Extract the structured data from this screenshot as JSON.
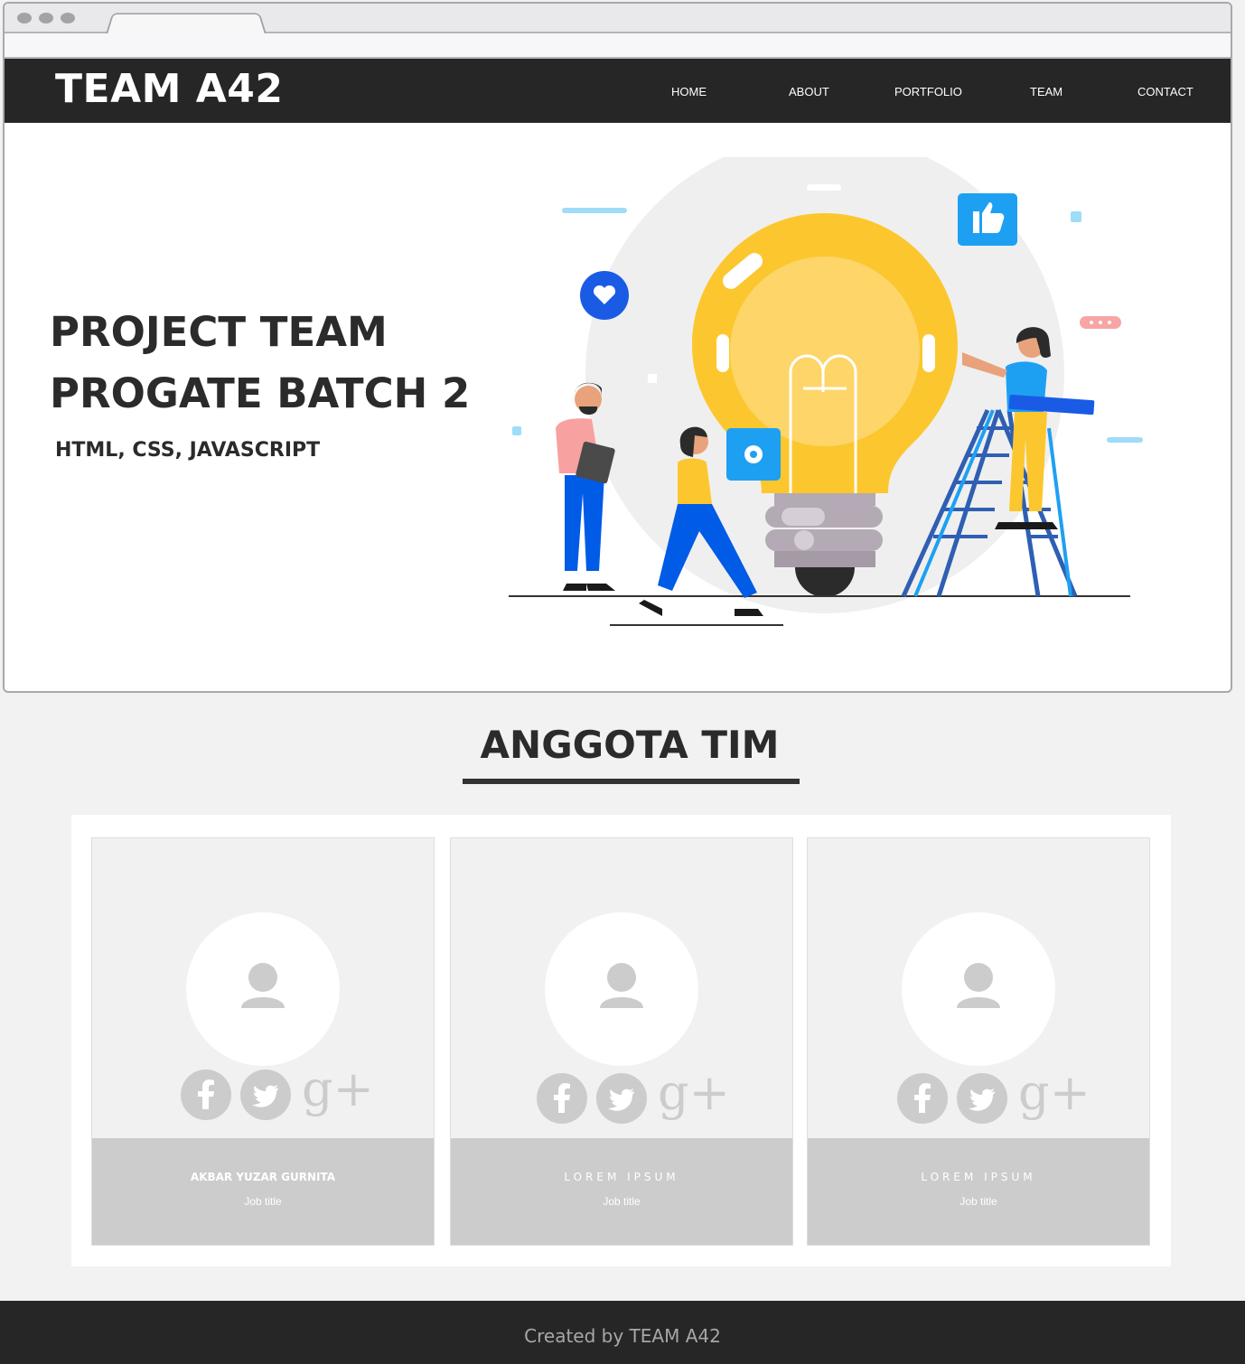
{
  "navbar": {
    "brand": "TEAM A42",
    "items": [
      "HOME",
      "ABOUT",
      "PORTFOLIO",
      "TEAM",
      "CONTACT"
    ]
  },
  "hero": {
    "title_line1": "PROJECT TEAM",
    "title_line2": "PROGATE BATCH 2",
    "subtitle": "HTML, CSS, JAVASCRIPT"
  },
  "team": {
    "title": "ANGGOTA TIM",
    "members": [
      {
        "name": "AKBAR YUZAR GURNITA",
        "job": "Job title"
      },
      {
        "name": "LOREM IPSUM",
        "job": "Job title"
      },
      {
        "name": "LOREM IPSUM",
        "job": "Job title"
      }
    ],
    "social_icons": [
      "facebook-icon",
      "twitter-icon",
      "google-plus-icon"
    ]
  },
  "footer": {
    "text": "Created by TEAM A42"
  },
  "colors": {
    "dark": "#262626",
    "text": "#2b2b2b",
    "card_bg": "#f1f1f1",
    "card_info": "#cccccc",
    "bulb_yellow": "#fcc72e",
    "accent_blue": "#1ea0f2"
  }
}
